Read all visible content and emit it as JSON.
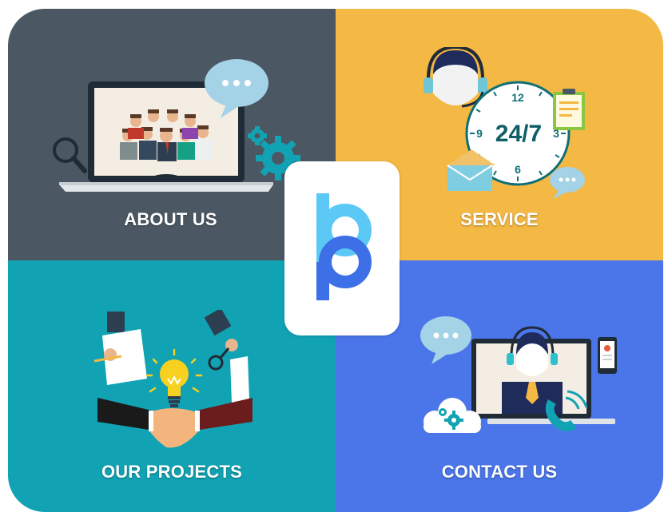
{
  "tiles": {
    "about": {
      "label": "ABOUT US"
    },
    "service": {
      "label": "SERVICE",
      "clock_center": "24/7",
      "clock_numbers": [
        "12",
        "3",
        "6",
        "9"
      ]
    },
    "projects": {
      "label": "OUR PROJECTS"
    },
    "contact": {
      "label": "CONTACT US"
    }
  },
  "colors": {
    "about_bg": "#4b5863",
    "service_bg": "#f4b844",
    "projects_bg": "#11a3b3",
    "contact_bg": "#4a76e9",
    "logo_light": "#5bc8f5",
    "logo_dark": "#3d6fe6"
  },
  "icons": {
    "about": [
      "laptop-icon",
      "team-icon",
      "chat-bubble-icon",
      "gear-icon",
      "magnifier-icon"
    ],
    "service": [
      "headset-agent-icon",
      "clock-icon",
      "clipboard-icon",
      "envelope-icon",
      "chat-bubble-icon"
    ],
    "projects": [
      "hands-documents-icon",
      "lightbulb-icon",
      "handshake-icon"
    ],
    "contact": [
      "monitor-icon",
      "agent-icon",
      "phone-icon",
      "cloud-gear-icon",
      "chat-bubble-icon",
      "smartphone-icon"
    ],
    "center": "logo-icon"
  }
}
